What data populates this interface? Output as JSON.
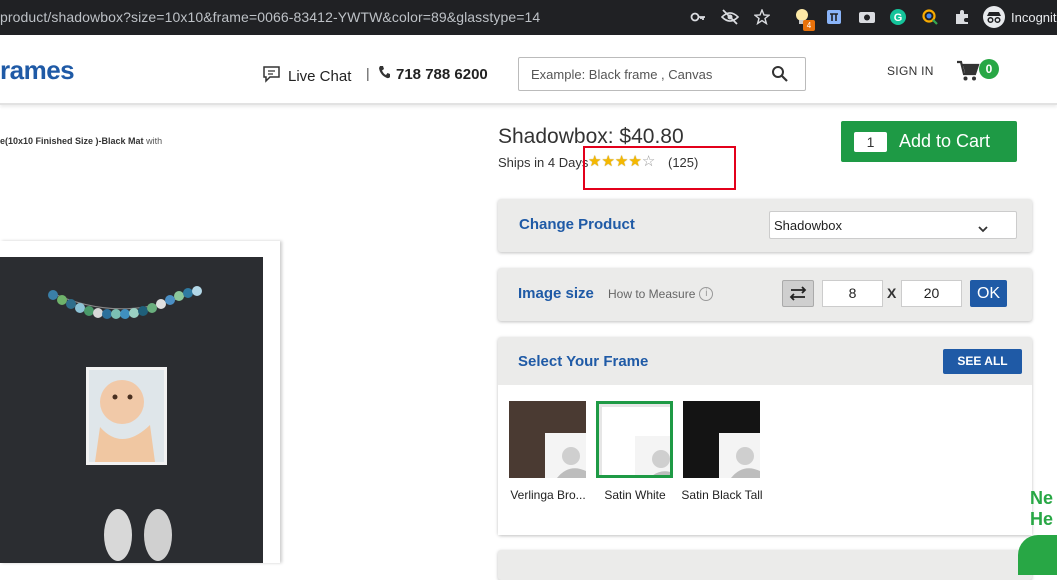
{
  "browser": {
    "url": "product/shadowbox?size=10x10&frame=0066-83412-YWTW&color=89&glasstype=14",
    "extension_badge": "4",
    "profile_label": "Incognito"
  },
  "header": {
    "logo_text": "rames",
    "live_chat": "Live Chat",
    "divider": "|",
    "phone": "718 788 6200",
    "search_placeholder": "Example: Black frame , Canvas",
    "sign_in": "SIGN IN",
    "cart_count": "0"
  },
  "preview": {
    "description": "e(10x10 Finished Size )-Black Mat",
    "description_suffix": "with"
  },
  "product": {
    "title": "Shadowbox: $40.80",
    "ships": "Ships in 4 Days",
    "rating": 4,
    "rating_max": 5,
    "reviews": "(125)",
    "qty": "1",
    "add_to_cart": "Add to Cart"
  },
  "change_product": {
    "label": "Change Product",
    "selected": "Shadowbox"
  },
  "image_size": {
    "label": "Image size",
    "how_to": "How to Measure",
    "width": "8",
    "x": "X",
    "height": "20",
    "ok": "OK"
  },
  "frames": {
    "label": "Select Your Frame",
    "see_all": "SEE ALL",
    "items": [
      {
        "name": "Verlinga Bro...",
        "color": "#4a3a32",
        "selected": false
      },
      {
        "name": "Satin White",
        "color": "#ffffff",
        "selected": true
      },
      {
        "name": "Satin Black Tall",
        "color": "#141414",
        "selected": false
      }
    ]
  },
  "help": {
    "line1": "Ne",
    "line2": "He"
  },
  "colors": {
    "brand_blue": "#1f5aa6",
    "cart_green": "#1e9a45",
    "highlight_red": "#e3001b",
    "star_gold": "#f5b800"
  }
}
